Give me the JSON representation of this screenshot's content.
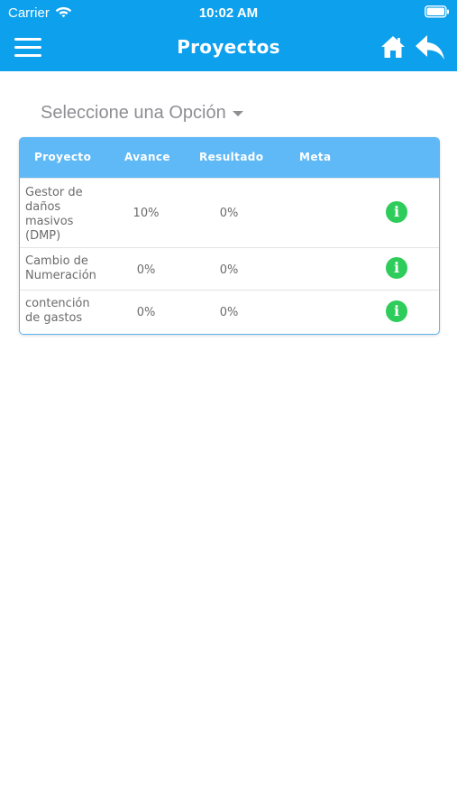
{
  "status_bar": {
    "carrier": "Carrier",
    "time": "10:02 AM"
  },
  "navbar": {
    "title": "Proyectos"
  },
  "selector": {
    "label": "Seleccione una Opción"
  },
  "table": {
    "headers": [
      "Proyecto",
      "Avance",
      "Resultado",
      "Meta"
    ],
    "rows": [
      {
        "proyecto": "Gestor de daños masivos (DMP)",
        "avance": "10%",
        "resultado": "0%",
        "meta": ""
      },
      {
        "proyecto": "Cambio de Numeración",
        "avance": "0%",
        "resultado": "0%",
        "meta": ""
      },
      {
        "proyecto": "contención de gastos",
        "avance": "0%",
        "resultado": "0%",
        "meta": ""
      }
    ]
  },
  "icons": {
    "menu": "menu-icon",
    "home": "home-icon",
    "back": "reply-icon",
    "info": "info-icon",
    "wifi": "wifi-icon",
    "battery": "battery-icon"
  },
  "colors": {
    "primary": "#0da0ec",
    "header": "#5fb9f6",
    "info": "#2ecc5a"
  }
}
